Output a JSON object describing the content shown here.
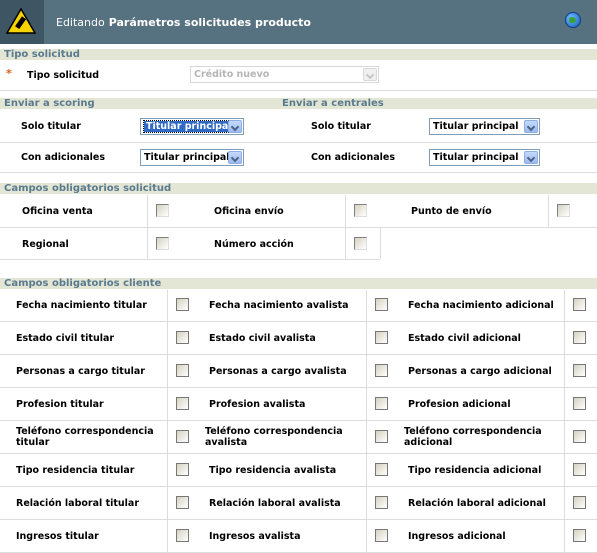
{
  "header": {
    "mode": "Editando",
    "title": "Parámetros solicitudes producto"
  },
  "tipo": {
    "section": "Tipo solicitud",
    "label": "Tipo solicitud",
    "value": "Crédito nuevo"
  },
  "envio": {
    "scoring_section": "Enviar a scoring",
    "centrales_section": "Enviar a centrales",
    "scoring": [
      {
        "label": "Solo titular",
        "value": "Titular principal"
      },
      {
        "label": "Con adicionales",
        "value": "Titular principal"
      }
    ],
    "centrales": [
      {
        "label": "Solo titular",
        "value": "Titular principal"
      },
      {
        "label": "Con adicionales",
        "value": "Titular principal"
      }
    ]
  },
  "solicitud": {
    "section": "Campos obligatorios solicitud",
    "fields": [
      "Oficina venta",
      "Oficina envío",
      "Punto de envío",
      "Regional",
      "Número acción"
    ]
  },
  "cliente": {
    "section": "Campos obligatorios cliente",
    "rows": [
      [
        "Fecha nacimiento titular",
        "Fecha nacimiento avalista",
        "Fecha nacimiento adicional"
      ],
      [
        "Estado civil titular",
        "Estado civil avalista",
        "Estado civil adicional"
      ],
      [
        "Personas a cargo titular",
        "Personas a cargo avalista",
        "Personas a cargo adicional"
      ],
      [
        "Profesion titular",
        "Profesion avalista",
        "Profesion adicional"
      ],
      [
        "Teléfono correspondencia titular",
        "Teléfono correspondencia avalista",
        "Teléfono correspondencia adicional"
      ],
      [
        "Tipo residencia titular",
        "Tipo residencia avalista",
        "Tipo residencia adicional"
      ],
      [
        "Relación laboral titular",
        "Relación laboral avalista",
        "Relación laboral adicional"
      ],
      [
        "Ingresos titular",
        "Ingresos avalista",
        "Ingresos adicional"
      ]
    ]
  }
}
